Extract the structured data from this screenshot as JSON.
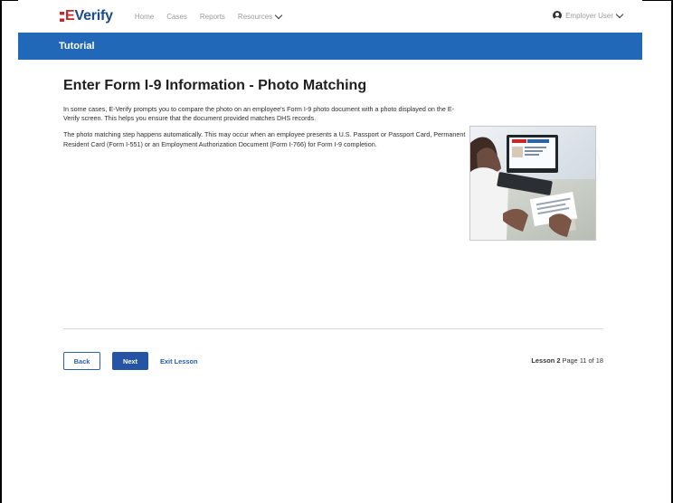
{
  "brand": {
    "logo_text": "E Verify"
  },
  "nav": {
    "items": [
      {
        "label": "Home"
      },
      {
        "label": "Cases"
      },
      {
        "label": "Reports"
      },
      {
        "label": "Resources"
      }
    ],
    "user_label": "Employer User"
  },
  "banner": {
    "title": "Tutorial"
  },
  "page": {
    "title": "Enter Form I-9 Information - Photo Matching",
    "paragraphs": [
      "In some cases, E-Verify prompts you to compare the photo on an employee's Form I-9 photo document with a photo displayed on the E-Verify screen. This helps you ensure that the document provided matches DHS records.",
      "The photo matching step happens automatically. This may occur when an employee presents a U.S. Passport or Passport Card, Permanent Resident Card (Form I-551) or an Employment Authorization Document (Form I-766) for Form I-9 completion."
    ]
  },
  "actions": {
    "back_label": "Back",
    "next_label": "Next",
    "exit_label": "Exit Lesson"
  },
  "lesson": {
    "lesson_label": "Lesson 2",
    "page_text": "Page 11 of 18"
  },
  "colors": {
    "accent": "#2168b8",
    "brand_red": "#c62828",
    "brand_blue": "#1a4b8c",
    "button_blue": "#2454a3"
  },
  "icons": {
    "user": "user-circle-icon",
    "chevron": "chevron-down-icon"
  }
}
